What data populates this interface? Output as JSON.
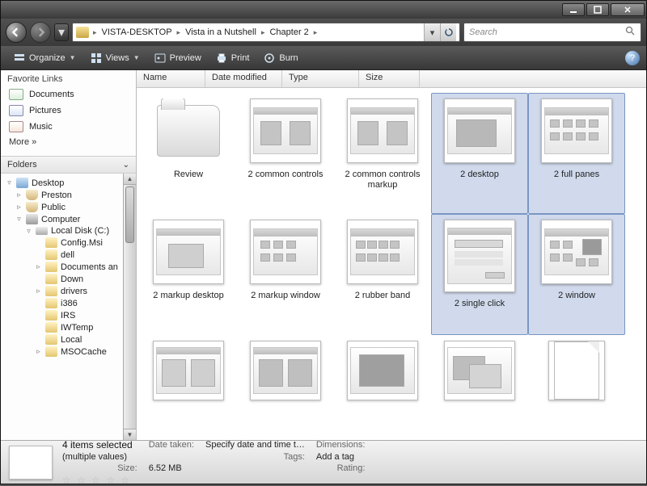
{
  "breadcrumb": {
    "root_icon": "computer",
    "seg1": "VISTA-DESKTOP",
    "seg2": "Vista in a Nutshell",
    "seg3": "Chapter 2"
  },
  "search": {
    "placeholder": "Search"
  },
  "toolbar": {
    "organize": "Organize",
    "views": "Views",
    "preview": "Preview",
    "print": "Print",
    "burn": "Burn"
  },
  "favorites": {
    "header": "Favorite Links",
    "documents": "Documents",
    "pictures": "Pictures",
    "music": "Music",
    "more": "More  »"
  },
  "folders": {
    "header": "Folders",
    "tree": {
      "desktop": "Desktop",
      "preston": "Preston",
      "public": "Public",
      "computer": "Computer",
      "localdisk": "Local Disk (C:)",
      "n0": "Config.Msi",
      "n1": "dell",
      "n2": "Documents an",
      "n3": "Down",
      "n4": "drivers",
      "n5": "i386",
      "n6": "IRS",
      "n7": "IWTemp",
      "n8": "Local",
      "n9": "MSOCache"
    }
  },
  "columns": {
    "name": "Name",
    "date": "Date modified",
    "type": "Type",
    "size": "Size"
  },
  "items": {
    "i0": {
      "label": "Review",
      "kind": "folder",
      "selected": false
    },
    "i1": {
      "label": "2 common controls",
      "kind": "image",
      "selected": false
    },
    "i2": {
      "label": "2 common controls markup",
      "kind": "image",
      "selected": false
    },
    "i3": {
      "label": "2 desktop",
      "kind": "image",
      "selected": true
    },
    "i4": {
      "label": "2 full panes",
      "kind": "image",
      "selected": true
    },
    "i5": {
      "label": "2 markup desktop",
      "kind": "image",
      "selected": false
    },
    "i6": {
      "label": "2 markup window",
      "kind": "image",
      "selected": false
    },
    "i7": {
      "label": "2 rubber band",
      "kind": "image",
      "selected": false
    },
    "i8": {
      "label": "2 single click",
      "kind": "image",
      "selected": true
    },
    "i9": {
      "label": "2 window",
      "kind": "image",
      "selected": true
    },
    "i10": {
      "label": "",
      "kind": "image",
      "selected": false
    },
    "i11": {
      "label": "",
      "kind": "image",
      "selected": false
    },
    "i12": {
      "label": "",
      "kind": "image",
      "selected": false
    },
    "i13": {
      "label": "",
      "kind": "image",
      "selected": false
    },
    "i14": {
      "label": "",
      "kind": "doc",
      "selected": false
    }
  },
  "details": {
    "title": "4 items selected",
    "date_taken_k": "Date taken:",
    "date_taken_v": "Specify date and time t…",
    "tags_k": "Tags:",
    "tags_v": "Add a tag",
    "rating_k": "Rating:",
    "dimensions_k": "Dimensions:",
    "dimensions_v": "(multiple values)",
    "size_k": "Size:",
    "size_v": "6.52 MB"
  }
}
